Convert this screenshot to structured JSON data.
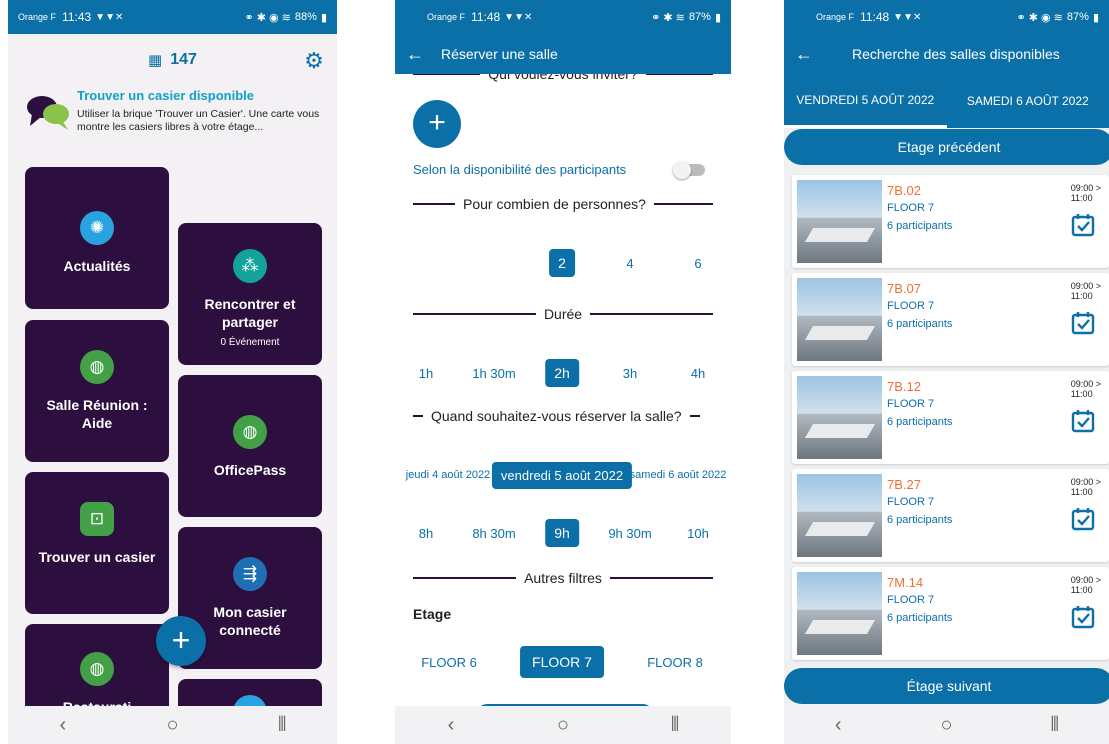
{
  "screen1": {
    "status": {
      "carrier": "Orange F",
      "time": "11:43",
      "battery": "88%"
    },
    "header": {
      "count": "147"
    },
    "tip": {
      "title": "Trouver un casier disponible",
      "desc": "Utiliser la brique 'Trouver un Casier'. Une carte vous montre les casiers libres à votre étage..."
    },
    "tiles": [
      {
        "label": "Actualités",
        "sub": ""
      },
      {
        "label": "Rencontrer et partager",
        "sub": "0 Événement"
      },
      {
        "label": "Salle Réunion : Aide",
        "sub": ""
      },
      {
        "label": "OfficePass",
        "sub": ""
      },
      {
        "label": "Trouver un casier",
        "sub": ""
      },
      {
        "label": "Mon casier connecté",
        "sub": ""
      },
      {
        "label": "Restaurati",
        "sub": ""
      }
    ]
  },
  "screen2": {
    "status": {
      "carrier": "Orange F",
      "time": "11:48",
      "battery": "87%"
    },
    "title": "Réserver une salle",
    "invite_heading": "Qui voulez-vous inviter?",
    "availability_label": "Selon la disponibilité des participants",
    "persons_heading": "Pour combien de personnes?",
    "persons": [
      "2",
      "4",
      "6"
    ],
    "duration_heading": "Durée",
    "durations": [
      "1h",
      "1h 30m",
      "2h",
      "3h",
      "4h"
    ],
    "when_heading": "Quand souhaitez-vous réserver la salle?",
    "dates": [
      "jeudi 4 août 2022",
      "vendredi 5 août 2022",
      "samedi 6 août 2022"
    ],
    "times": [
      "8h",
      "8h 30m",
      "9h",
      "9h 30m",
      "10h"
    ],
    "other_heading": "Autres filtres",
    "floor_label": "Etage",
    "floors": [
      "FLOOR 6",
      "FLOOR 7",
      "FLOOR 8"
    ]
  },
  "screen3": {
    "status": {
      "carrier": "Orange F",
      "time": "11:48",
      "battery": "87%"
    },
    "title": "Recherche des salles disponibles",
    "tabs": [
      "VENDREDI 5 AOÛT 2022",
      "SAMEDI 6 AOÛT 2022"
    ],
    "prev_floor": "Etage précédent",
    "next_floor": "Étage suivant",
    "rooms": [
      {
        "name": "7B.02",
        "floor": "FLOOR 7",
        "capacity": "6 participants",
        "start": "09:00 >",
        "end": "11:00"
      },
      {
        "name": "7B.07",
        "floor": "FLOOR 7",
        "capacity": "6 participants",
        "start": "09:00 >",
        "end": "11:00"
      },
      {
        "name": "7B.12",
        "floor": "FLOOR 7",
        "capacity": "6 participants",
        "start": "09:00 >",
        "end": "11:00"
      },
      {
        "name": "7B.27",
        "floor": "FLOOR 7",
        "capacity": "6 participants",
        "start": "09:00 >",
        "end": "11:00"
      },
      {
        "name": "7M.14",
        "floor": "FLOOR 7",
        "capacity": "6 participants",
        "start": "09:00 >",
        "end": "11:00"
      }
    ]
  },
  "colors": {
    "primary": "#0b6fa8",
    "tile": "#2c0f3f",
    "accent": "#f06f38",
    "tip_title": "#12a0c9"
  }
}
